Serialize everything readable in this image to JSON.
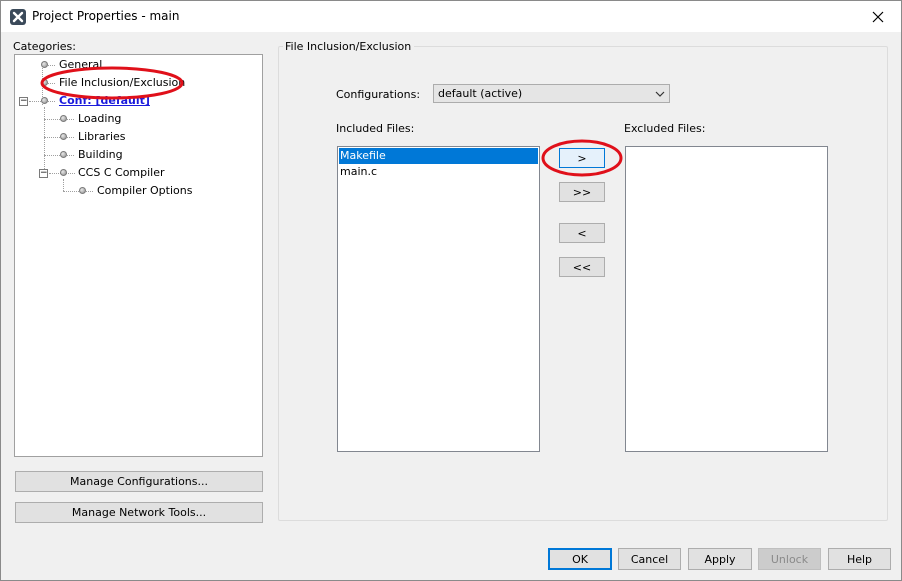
{
  "window": {
    "title": "Project Properties - main",
    "app_icon": "tool-icon",
    "close_glyph": "✕"
  },
  "categories": {
    "label": "Categories:",
    "items": [
      {
        "label": "General",
        "level": 1
      },
      {
        "label": "File Inclusion/Exclusion",
        "level": 1,
        "highlighted": true
      },
      {
        "label": "Conf: [default]",
        "level": 1,
        "expanded": true,
        "link": true
      },
      {
        "label": "Loading",
        "level": 2
      },
      {
        "label": "Libraries",
        "level": 2
      },
      {
        "label": "Building",
        "level": 2
      },
      {
        "label": "CCS C Compiler",
        "level": 2,
        "expanded": true
      },
      {
        "label": "Compiler Options",
        "level": 3
      }
    ]
  },
  "left_buttons": {
    "manage_configurations": "Manage Configurations...",
    "manage_network_tools": "Manage Network Tools..."
  },
  "panel": {
    "group_title": "File Inclusion/Exclusion",
    "configurations_label": "Configurations:",
    "configurations_value": "default (active)",
    "included_label": "Included Files:",
    "excluded_label": "Excluded Files:",
    "included_files": [
      {
        "name": "Makefile",
        "selected": true
      },
      {
        "name": "main.c",
        "selected": false
      }
    ],
    "excluded_files": [],
    "move_buttons": {
      "move_right": ">",
      "move_all_right": ">>",
      "move_left": "<",
      "move_all_left": "<<"
    }
  },
  "footer": {
    "ok": "OK",
    "cancel": "Cancel",
    "apply": "Apply",
    "unlock": "Unlock",
    "help": "Help"
  },
  "colors": {
    "selection": "#0078d7",
    "annotation": "#e0101a",
    "link": "#1a1adc"
  }
}
